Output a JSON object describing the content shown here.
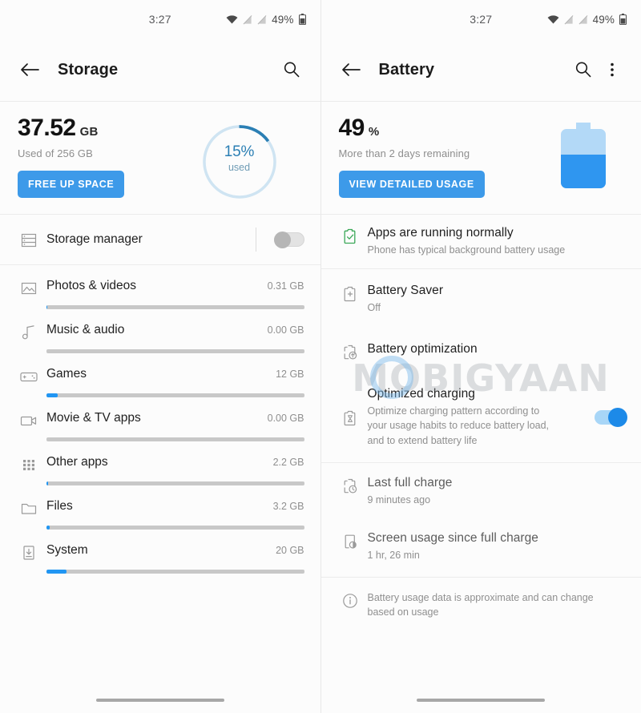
{
  "colors": {
    "accent_blue": "#3d9ae9",
    "bar_fill": "#2196f3",
    "donut_track": "#cfe4f2",
    "donut_arc": "#2b7fb4",
    "battery_light": "#b3d9f7",
    "battery_fill": "#2f96f0",
    "toggle_on": "#1d8ae8",
    "green": "#3aa757",
    "text_primary": "#1f1f1f",
    "text_secondary": "#8f8f8f"
  },
  "watermark": {
    "text": "MOBIGYAAN"
  },
  "status_bar": {
    "time": "3:27",
    "battery_percent": "49%",
    "icons": [
      "wifi-icon",
      "no-signal-icon",
      "no-signal-icon",
      "battery-icon"
    ]
  },
  "storage_screen": {
    "appbar": {
      "title": "Storage",
      "back_icon": "back-arrow-icon",
      "search_icon": "search-icon"
    },
    "summary": {
      "used_value": "37.52",
      "used_unit": "GB",
      "subtitle": "Used of 256 GB",
      "cta_label": "FREE UP SPACE",
      "donut_percent_label": "15%",
      "donut_caption": "used",
      "donut_percent_value": 15
    },
    "storage_manager": {
      "label": "Storage manager",
      "icon": "storage-manager-icon",
      "toggle_state": "off"
    },
    "categories": [
      {
        "icon": "photos-icon",
        "label": "Photos & videos",
        "value": "0.31 GB",
        "fill_percent": 0.3
      },
      {
        "icon": "music-icon",
        "label": "Music & audio",
        "value": "0.00 GB",
        "fill_percent": 0
      },
      {
        "icon": "games-icon",
        "label": "Games",
        "value": "12 GB",
        "fill_percent": 4.2
      },
      {
        "icon": "movie-icon",
        "label": "Movie & TV apps",
        "value": "0.00 GB",
        "fill_percent": 0
      },
      {
        "icon": "apps-icon",
        "label": "Other apps",
        "value": "2.2 GB",
        "fill_percent": 0.5
      },
      {
        "icon": "folder-icon",
        "label": "Files",
        "value": "3.2 GB",
        "fill_percent": 1.3
      },
      {
        "icon": "system-icon",
        "label": "System",
        "value": "20 GB",
        "fill_percent": 7.8
      }
    ]
  },
  "battery_screen": {
    "appbar": {
      "title": "Battery",
      "back_icon": "back-arrow-icon",
      "search_icon": "search-icon",
      "overflow_icon": "more-vertical-icon"
    },
    "summary": {
      "level_value": "49",
      "level_unit": "%",
      "subtitle": "More than 2 days remaining",
      "cta_label": "VIEW DETAILED USAGE",
      "battery_fill_percent": 49
    },
    "status_item": {
      "icon": "battery-ok-icon",
      "title": "Apps are running normally",
      "subtitle": "Phone has typical background battery usage"
    },
    "items": [
      {
        "icon": "battery-saver-icon",
        "title": "Battery Saver",
        "subtitle": "Off",
        "toggle": null
      },
      {
        "icon": "battery-optimization-icon",
        "title": "Battery optimization",
        "subtitle": "",
        "toggle": null
      },
      {
        "icon": "optimized-charging-icon",
        "title": "Optimized charging",
        "subtitle": "Optimize charging pattern according to your usage habits to reduce battery load, and to extend battery life",
        "toggle": "on"
      }
    ],
    "info_items": [
      {
        "icon": "last-charge-icon",
        "title": "Last full charge",
        "subtitle": "9 minutes ago"
      },
      {
        "icon": "screen-usage-icon",
        "title": "Screen usage since full charge",
        "subtitle": "1 hr, 26 min"
      }
    ],
    "footer_note": {
      "icon": "info-icon",
      "text": "Battery usage data is approximate and can change based on usage"
    }
  }
}
